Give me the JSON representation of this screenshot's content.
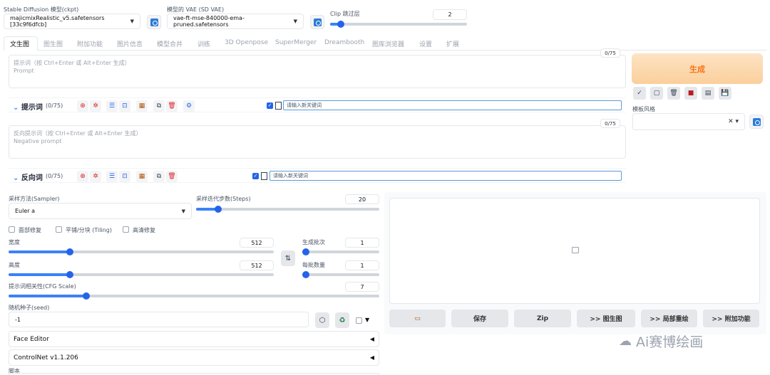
{
  "top": {
    "ckpt_label": "Stable Diffusion 模型(ckpt)",
    "ckpt_value": "majicmixRealistic_v5.safetensors [33c9f6dfcb]",
    "vae_label": "模型的 VAE (SD VAE)",
    "vae_value": "vae-ft-mse-840000-ema-pruned.safetensors",
    "clip_label": "Clip 跳过层",
    "clip_value": "2",
    "clip_fraction": 0.08
  },
  "tabs": [
    {
      "label": "文生图"
    },
    {
      "label": "图生图"
    },
    {
      "label": "附加功能"
    },
    {
      "label": "图片信息"
    },
    {
      "label": "模型合并"
    },
    {
      "label": "训练"
    },
    {
      "label": "3D Openpose"
    },
    {
      "label": "SuperMerger"
    },
    {
      "label": "Dreambooth"
    },
    {
      "label": "图库浏览器"
    },
    {
      "label": "设置"
    },
    {
      "label": "扩展"
    }
  ],
  "prompt": {
    "counter": "0/75",
    "placeholder_cn": "提示词（按 Ctrl+Enter 或 Alt+Enter 生成）",
    "placeholder_en": "Prompt",
    "toolbar_title": "提示词",
    "toolbar_count": "(0/75)",
    "keyword_placeholder": "请输入新关键词"
  },
  "negative": {
    "counter": "0/75",
    "placeholder_cn": "反向提示词（按 Ctrl+Enter 或 Alt+Enter 生成）",
    "placeholder_en": "Negative prompt",
    "toolbar_title": "反向词",
    "toolbar_count": "(0/75)",
    "keyword_placeholder": "请输入新关键词"
  },
  "right": {
    "generate_label": "生成",
    "style_label": "模板风格",
    "icons": [
      "check-icon",
      "copy-icon",
      "trash-icon",
      "bookmark-icon",
      "clipboard-icon",
      "save-icon"
    ]
  },
  "sampler": {
    "label": "采样方法(Sampler)",
    "value": "Euler a",
    "steps_label": "采样迭代步数(Steps)",
    "steps_value": "20",
    "steps_fraction": 0.12
  },
  "options": {
    "face_restore": "面部修复",
    "tiling": "平铺/分块 (Tiling)",
    "hires": "高清修复"
  },
  "dims": {
    "width_label": "宽度",
    "width_value": "512",
    "width_fraction": 0.23,
    "height_label": "高度",
    "height_value": "512",
    "height_fraction": 0.23,
    "batch_count_label": "生成批次",
    "batch_count_value": "1",
    "batch_count_fraction": 0.0,
    "batch_size_label": "每批数量",
    "batch_size_value": "1",
    "batch_size_fraction": 0.0
  },
  "cfg": {
    "label": "提示词相关性(CFG Scale)",
    "value": "7",
    "fraction": 0.21
  },
  "seed": {
    "label": "随机种子(seed)",
    "value": "-1"
  },
  "accordions": [
    {
      "label": "Face Editor"
    },
    {
      "label": "ControlNet v1.1.206"
    }
  ],
  "script_label": "脚本",
  "output_buttons": {
    "save": "保存",
    "zip": "Zip",
    "to_img2img": ">> 图生图",
    "to_inpaint": ">> 局部重绘",
    "to_extras": ">> 附加功能"
  },
  "watermark": "Ai赛博绘画",
  "colors": {
    "accent": "#2563eb",
    "generate_text": "#f97316",
    "generate_bg": "#fcd9b0"
  }
}
